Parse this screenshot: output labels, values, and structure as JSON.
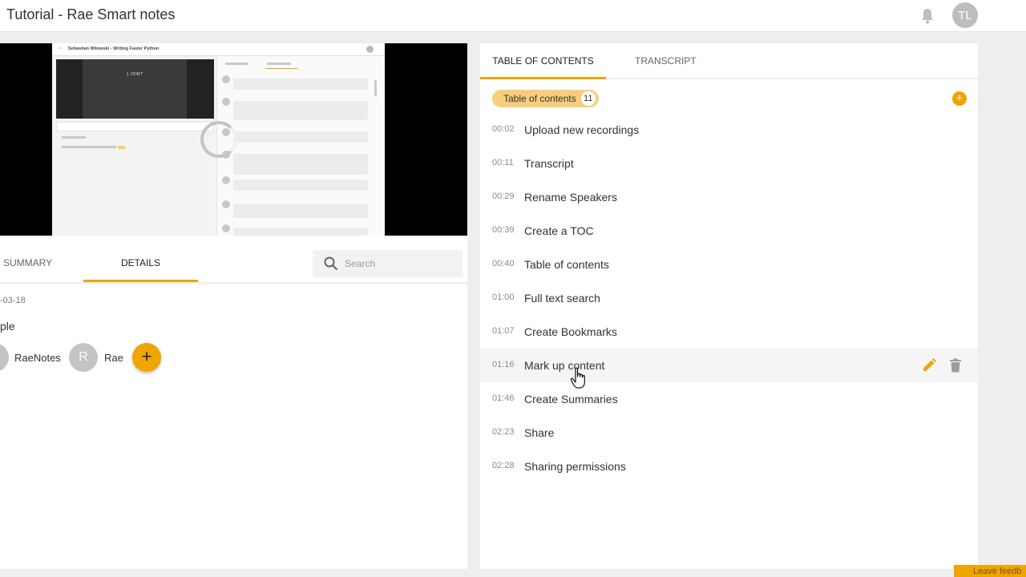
{
  "header": {
    "title": "Tutorial - Rae Smart notes",
    "avatar_initials": "TL"
  },
  "video": {
    "thumbnail_title": "Sebastian Witowski - Writing Faster Python",
    "thumbnail_slide_text": "1. DON'T"
  },
  "left_tabs": {
    "summary": "SUMMARY",
    "details": "DETAILS"
  },
  "search": {
    "placeholder": "Search"
  },
  "details": {
    "date": "-03-18",
    "name": "ple",
    "participants": [
      {
        "initial": "",
        "name": "RaeNotes"
      },
      {
        "initial": "R",
        "name": "Rae"
      }
    ],
    "add_label": "+"
  },
  "right_tabs": {
    "toc": "TABLE OF CONTENTS",
    "transcript": "TRANSCRIPT"
  },
  "toc": {
    "chip_label": "Table of contents",
    "count": "11",
    "add_label": "+",
    "items": [
      {
        "time": "00:02",
        "label": "Upload new recordings"
      },
      {
        "time": "00:11",
        "label": "Transcript"
      },
      {
        "time": "00:29",
        "label": "Rename Speakers"
      },
      {
        "time": "00:39",
        "label": "Create a TOC"
      },
      {
        "time": "00:40",
        "label": "Table of contents"
      },
      {
        "time": "01:00",
        "label": "Full text search"
      },
      {
        "time": "01:07",
        "label": "Create Bookmarks"
      },
      {
        "time": "01:16",
        "label": "Mark up content"
      },
      {
        "time": "01:46",
        "label": "Create Summaries"
      },
      {
        "time": "02:23",
        "label": "Share"
      },
      {
        "time": "02:28",
        "label": "Sharing permissions"
      }
    ]
  },
  "feedback_label": "Leave feedb",
  "colors": {
    "accent": "#f0a500",
    "chip": "#f8ce7c",
    "avatar": "#bdbdbd"
  }
}
